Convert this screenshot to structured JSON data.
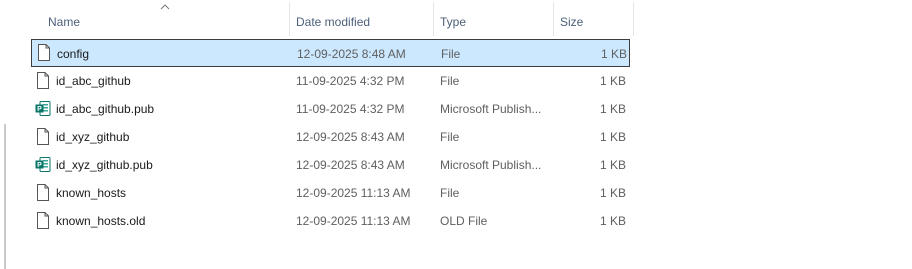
{
  "columns": {
    "name": "Name",
    "date_modified": "Date modified",
    "type": "Type",
    "size": "Size"
  },
  "sort": {
    "column": "name",
    "direction": "ascending"
  },
  "files": [
    {
      "name": "config",
      "date": "12-09-2025 8:48 AM",
      "type": "File",
      "size": "1 KB",
      "icon": "file-icon",
      "selected": true
    },
    {
      "name": "id_abc_github",
      "date": "11-09-2025 4:32 PM",
      "type": "File",
      "size": "1 KB",
      "icon": "file-icon",
      "selected": false
    },
    {
      "name": "id_abc_github.pub",
      "date": "11-09-2025 4:32 PM",
      "type": "Microsoft Publish...",
      "size": "1 KB",
      "icon": "publisher-icon",
      "selected": false
    },
    {
      "name": "id_xyz_github",
      "date": "12-09-2025 8:43 AM",
      "type": "File",
      "size": "1 KB",
      "icon": "file-icon",
      "selected": false
    },
    {
      "name": "id_xyz_github.pub",
      "date": "12-09-2025 8:43 AM",
      "type": "Microsoft Publish...",
      "size": "1 KB",
      "icon": "publisher-icon",
      "selected": false
    },
    {
      "name": "known_hosts",
      "date": "12-09-2025 11:13 AM",
      "type": "File",
      "size": "1 KB",
      "icon": "file-icon",
      "selected": false
    },
    {
      "name": "known_hosts.old",
      "date": "12-09-2025 11:13 AM",
      "type": "OLD File",
      "size": "1 KB",
      "icon": "file-icon",
      "selected": false
    }
  ],
  "colors": {
    "selection_bg": "#cce8ff",
    "selection_border": "#3d3d3d",
    "header_text": "#4c607a",
    "publisher_green": "#077568"
  }
}
